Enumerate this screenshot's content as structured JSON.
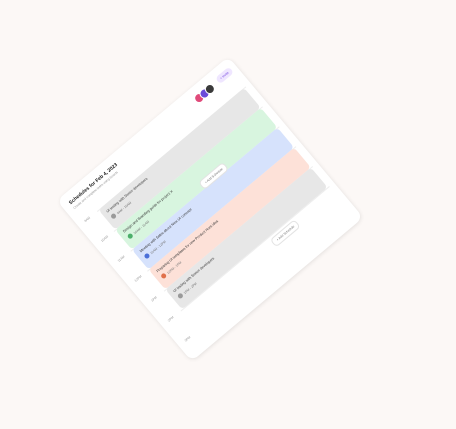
{
  "header": {
    "title": "Schedules for Feb 4, 2023",
    "subtitle": "Create and complete tasks using boards",
    "invite_label": "+ Invite"
  },
  "colors": {
    "gray": "#e7e7e7",
    "green": "#d8f5df",
    "blue": "#d6e2fc",
    "peach": "#fde1d8"
  },
  "time_slots": [
    "9AM",
    "10AM",
    "11AM",
    "12PM",
    "1PM",
    "2PM",
    "3PM"
  ],
  "events": [
    {
      "title": "UI testing with Senior developers",
      "time": "9AM - 10AM"
    },
    {
      "title": "Design and Branding guide for project X",
      "time": "10AM - 11AM"
    },
    {
      "title": "Meeting with Sales about New UI concept",
      "time": "11AM - 12PM"
    },
    {
      "title": "Preparing UI templates for new Product Hunt idea",
      "time": "12PM - 1PM"
    },
    {
      "title": "UI testing with Senior developers",
      "time": "1PM - 2PM"
    }
  ],
  "add_label": "+ Add Schedule"
}
